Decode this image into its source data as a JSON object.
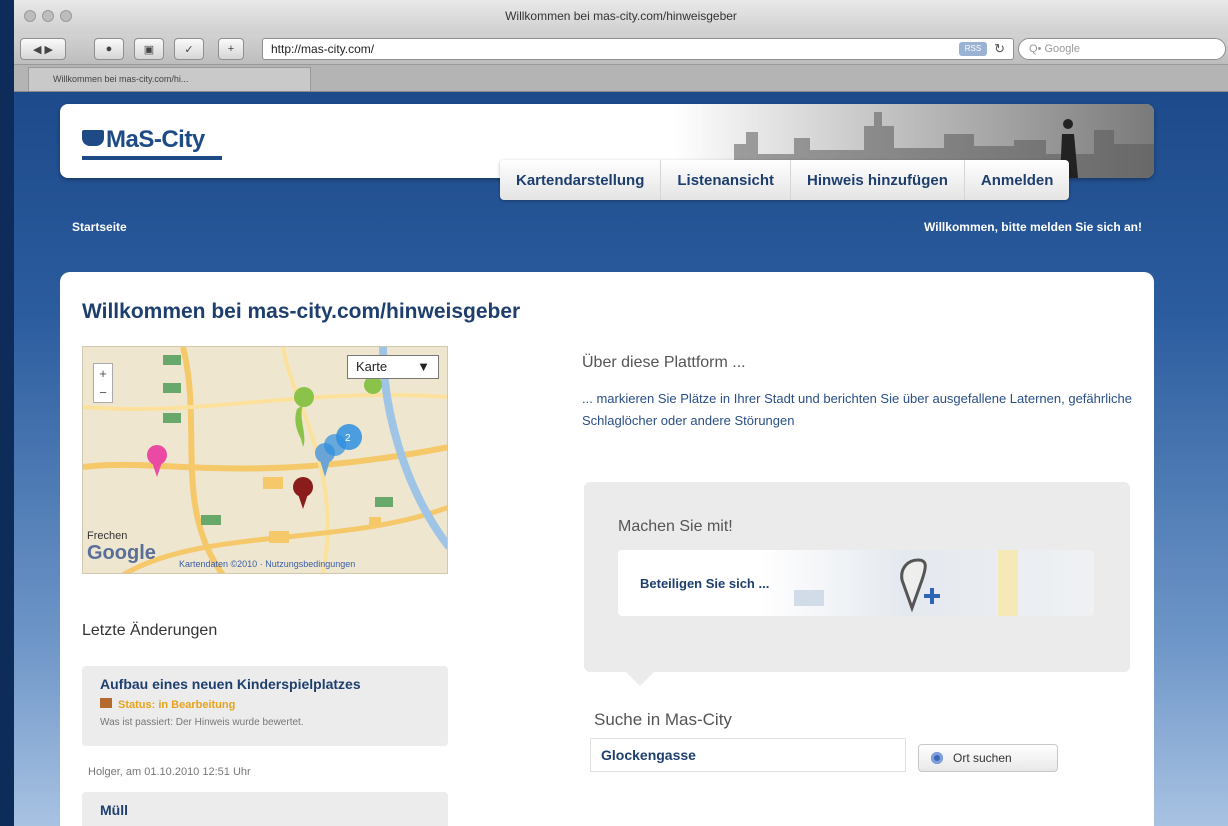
{
  "browser": {
    "title": "Willkommen bei mas-city.com/hinweisgeber",
    "url": "http://mas-city.com/",
    "search_placeholder": "Q• Google",
    "tab_label": "Willkommen bei mas-city.com/hi...",
    "back_label": "◀",
    "forward_label": "▶",
    "add_label": "+",
    "rss_label": "RSS",
    "reload_label": "↻"
  },
  "site": {
    "logo": "MaS-City",
    "nav": [
      {
        "label": "Kartendarstellung"
      },
      {
        "label": "Listenansicht"
      },
      {
        "label": "Hinweis hinzufügen"
      },
      {
        "label": "Anmelden"
      }
    ],
    "breadcrumb": "Startseite",
    "welcome": "Willkommen, bitte melden Sie sich an!"
  },
  "main": {
    "title": "Willkommen bei mas-city.com/hinweisgeber",
    "map": {
      "type_select": "Karte",
      "zoom_in": "+",
      "zoom_out": "−",
      "brand": "Google",
      "place": "Frechen",
      "copyright": "Kartendaten ©2010 · Nutzungsbedingungen",
      "cluster_count": "2"
    },
    "recent": {
      "title": "Letzte Änderungen",
      "items": [
        {
          "title": "Aufbau eines neuen Kinderspielplatzes",
          "status": "Status: in Bearbeitung",
          "desc": "Was ist passiert: Der Hinweis wurde bewertet.",
          "meta": "Holger, am 01.10.2010 12:51 Uhr"
        },
        {
          "title": "Müll"
        }
      ]
    },
    "about": {
      "title": "Über diese Plattform ...",
      "text": "... markieren Sie Plätze in Ihrer Stadt und berichten Sie über ausgefallene Laternen, gefährliche Schlaglöcher oder andere Störungen"
    },
    "join": {
      "title": "Machen Sie mit!",
      "link": "Beteiligen Sie sich ..."
    },
    "search": {
      "title": "Suche in Mas-City",
      "value": "Glockengasse",
      "button": "Ort suchen"
    }
  },
  "colors": {
    "brand": "#1e4a86",
    "status": "#e7a21d"
  }
}
